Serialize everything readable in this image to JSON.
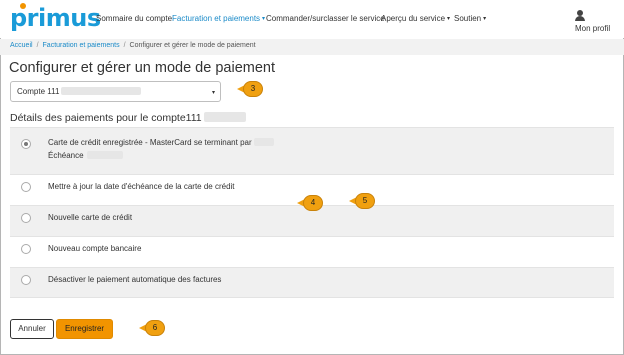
{
  "brand": {
    "logo_text": "primus"
  },
  "nav": {
    "items": [
      {
        "label": "Sommaire du compte",
        "dropdown": false,
        "active": false
      },
      {
        "label": "Facturation et paiements",
        "dropdown": true,
        "active": true
      },
      {
        "label": "Commander/surclasser le service",
        "dropdown": false,
        "active": false
      },
      {
        "label": "Aperçu du service",
        "dropdown": true,
        "active": false
      },
      {
        "label": "Soutien",
        "dropdown": true,
        "active": false
      }
    ],
    "profile_label": "Mon profil",
    "profile_icon": "user-icon",
    "caret_glyph": "▾"
  },
  "breadcrumb": {
    "items": [
      "Accueil",
      "Facturation et paiements",
      "Configurer et gérer le mode de paiement"
    ],
    "separator": "/"
  },
  "page": {
    "title": "Configurer et gérer un mode de paiement",
    "account_select": {
      "value_prefix": "Compte 111"
    },
    "section_title_prefix": "Détails des paiements pour le compte111"
  },
  "options": [
    {
      "label": "Carte de crédit enregistrée - MasterCard se terminant par",
      "sublabel": "Échéance",
      "checked": true
    },
    {
      "label": "Mettre à jour la date d'échéance de la carte de crédit",
      "checked": false
    },
    {
      "label": "Nouvelle carte de crédit",
      "checked": false
    },
    {
      "label": "Nouveau compte bancaire",
      "checked": false
    },
    {
      "label": "Désactiver le paiement automatique des factures",
      "checked": false
    }
  ],
  "buttons": {
    "cancel": "Annuler",
    "save": "Enregistrer"
  },
  "callouts": [
    "3",
    "4",
    "5",
    "6"
  ],
  "colors": {
    "brand_blue": "#1a9bd8",
    "accent_orange": "#f29400",
    "link_blue": "#1a8ac8"
  }
}
